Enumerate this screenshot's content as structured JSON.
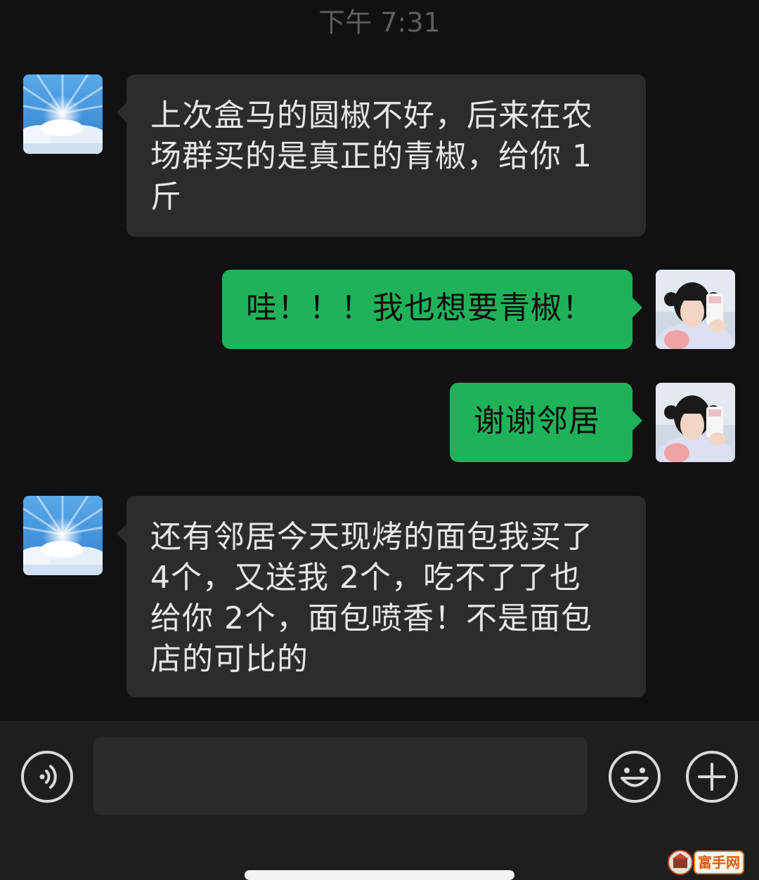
{
  "timestamp": "下午 7:31",
  "messages": [
    {
      "direction": "incoming",
      "avatar": "sky-avatar",
      "lines": [
        "上次盒马的圆椒不好，后来在农",
        "场群买的是真正的青椒，给你 1",
        "斤"
      ]
    },
    {
      "direction": "outgoing",
      "avatar": "girl-avatar",
      "lines": [
        "哇！！！我也想要青椒！"
      ]
    },
    {
      "direction": "outgoing",
      "avatar": "girl-avatar",
      "lines": [
        "谢谢邻居"
      ]
    },
    {
      "direction": "incoming",
      "avatar": "sky-avatar",
      "lines": [
        "还有邻居今天现烤的面包我买了",
        "4个，又送我 2个，吃不了了也",
        "给你 2个，面包喷香！不是面包",
        "店的可比的"
      ]
    }
  ],
  "input_bar": {
    "input_value": "",
    "voice_icon": "voice-icon",
    "emoji_icon": "emoji-icon",
    "plus_icon": "plus-icon"
  },
  "watermark": {
    "text": "富手网"
  },
  "colors": {
    "background": "#111111",
    "incoming_bubble": "#2c2c2c",
    "outgoing_bubble": "#1fb25a",
    "input_bar": "#1e1e1e"
  }
}
